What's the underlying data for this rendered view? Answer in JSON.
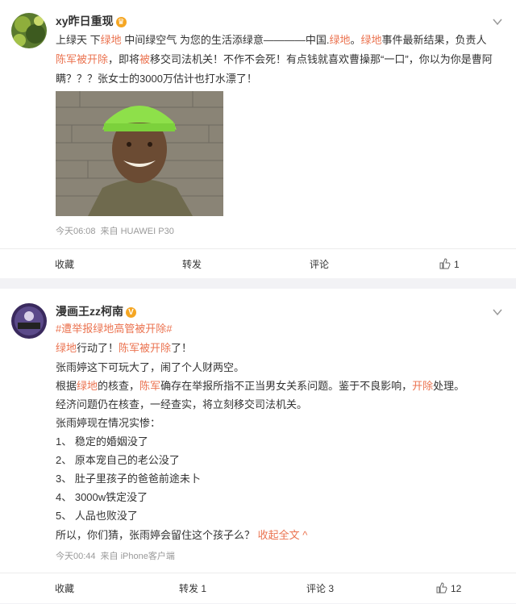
{
  "posts": [
    {
      "username": "xy昨日重现",
      "badge": "♛",
      "body": {
        "l1": {
          "a": "上绿天 下",
          "b": "绿地",
          "c": " 中间绿空气 为您的生活添绿意————中国.",
          "d": "绿地",
          "e": "。",
          "f": "绿地",
          "g": "事件最新结果，负责人"
        },
        "l2": {
          "a": "陈军被开除",
          "b": "，即将",
          "c": "被",
          "d": "移交司法机关！不作不会死！有点钱就喜欢曹操那“一口”，你以为你是曹阿"
        },
        "l3": "瞒？？？张女士的3000万估计也打水漂了！"
      },
      "time": "今天06:08",
      "source": "来自 HUAWEI P30",
      "actions": {
        "collect": "收藏",
        "repost": "转发",
        "comment": "评论",
        "like_count": "1"
      }
    },
    {
      "username": "漫画王zz柯南",
      "badge": "V",
      "hashtag": "#遭举报绿地高管被开除#",
      "body": {
        "l1": {
          "a": "绿地",
          "b": "行动了！",
          "c": "陈军被开除",
          "d": "了！"
        },
        "l2": "张雨婷这下可玩大了，闹了个人财两空。",
        "l3": {
          "a": "根据",
          "b": "绿地",
          "c": "的核查，",
          "d": "陈军",
          "e": "确存在举报所指不正当男女关系问题。鉴于不良影响，",
          "f": "开除",
          "g": "处理。"
        },
        "l4": "经济问题仍在核查，一经查实，将立刻移交司法机关。",
        "l5": "张雨婷现在情况实惨：",
        "l6": "1、 稳定的婚姻没了",
        "l7": "2、 原本宠自己的老公没了",
        "l8": "3、 肚子里孩子的爸爸前途未卜",
        "l9": "4、 3000w铁定没了",
        "l10": "5、 人品也败没了",
        "l11": {
          "a": "所以，你们猜，张雨婷会留住这个孩子么？ ",
          "b": "收起全文 ^"
        }
      },
      "time": "今天00:44",
      "source": "来自 iPhone客户端",
      "actions": {
        "collect": "收藏",
        "repost": "转发 1",
        "comment": "评论 3",
        "like_count": "12"
      }
    }
  ],
  "colors": {
    "highlight": "#eb7350",
    "text": "#333333",
    "meta": "#999999",
    "background": "#f2f2f5"
  },
  "icons": [
    "chevron-down-icon",
    "thumb-up-icon",
    "crown-badge-icon",
    "verified-v-icon"
  ]
}
